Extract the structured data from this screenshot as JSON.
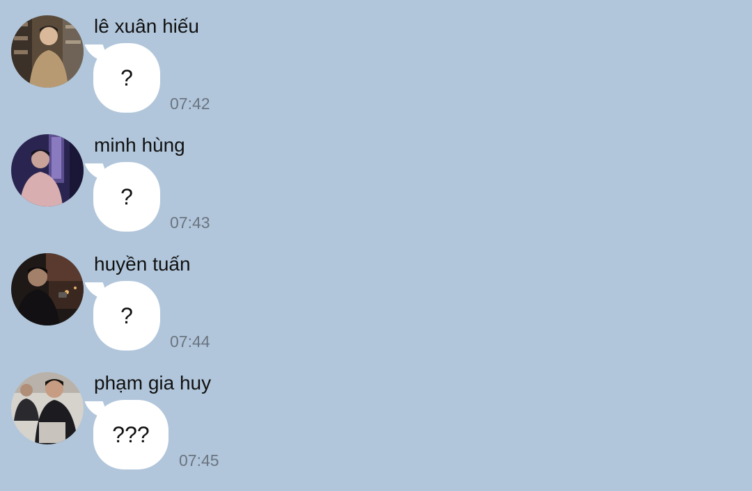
{
  "colors": {
    "background": "#b1c6db",
    "bubble": "#ffffff",
    "sender_text": "#111111",
    "timestamp_text": "#6b7480"
  },
  "messages": [
    {
      "sender": "lê xuân hiếu",
      "text": "?",
      "time": "07:42",
      "avatar": "user-avatar-photo"
    },
    {
      "sender": "minh hùng",
      "text": "?",
      "time": "07:43",
      "avatar": "user-avatar-photo"
    },
    {
      "sender": "huyền tuấn",
      "text": "?",
      "time": "07:44",
      "avatar": "user-avatar-photo"
    },
    {
      "sender": "phạm gia huy",
      "text": "???",
      "time": "07:45",
      "avatar": "user-avatar-photo"
    }
  ]
}
